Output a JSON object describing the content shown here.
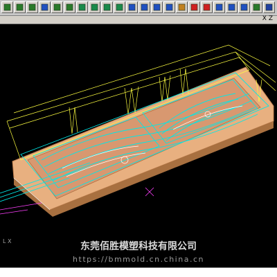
{
  "toolbar": {
    "buttons": [
      {
        "name": "zoom-window-icon",
        "color": "#2a7a2a"
      },
      {
        "name": "zoom-fit-icon",
        "color": "#2a7a2a"
      },
      {
        "name": "zoom-in-icon",
        "color": "#2a7a2a"
      },
      {
        "name": "pan-icon",
        "color": "#2050c0"
      },
      {
        "name": "rubber-band-icon",
        "color": "#2a7a2a"
      },
      {
        "name": "rotate-view-icon",
        "color": "#2a7a2a"
      },
      {
        "name": "iso-view-icon",
        "color": "#1a8a4a"
      },
      {
        "name": "top-view-icon",
        "color": "#1a8a4a"
      },
      {
        "name": "front-view-icon",
        "color": "#1a8a4a"
      },
      {
        "name": "side-view-icon",
        "color": "#1a8a4a"
      },
      {
        "name": "cube-view-icon",
        "color": "#2050c0"
      },
      {
        "name": "cube-back-icon",
        "color": "#2050c0"
      },
      {
        "name": "cube-right-icon",
        "color": "#2050c0"
      },
      {
        "name": "cube-left-icon",
        "color": "#2050c0"
      },
      {
        "name": "pencil-icon",
        "color": "#c08020"
      },
      {
        "name": "cancel-icon",
        "color": "#d02020"
      },
      {
        "name": "color-palette-icon",
        "color": "#d02020"
      },
      {
        "name": "shade-icon",
        "color": "#2050c0"
      },
      {
        "name": "undo-arrow-icon",
        "color": "#2050c0"
      },
      {
        "name": "sphere-icon",
        "color": "#2050c0"
      },
      {
        "name": "layers-icon",
        "color": "#2a7a2a"
      },
      {
        "name": "sum-icon",
        "color": "#2040a0"
      }
    ]
  },
  "viewport": {
    "axis_label": "X Z",
    "coord_label": "L X",
    "colors": {
      "background": "#000000",
      "plate": "#e8b080",
      "wire": "#00e8e8",
      "yellow": "#ffff40",
      "white": "#ffffff",
      "magenta": "#ff40ff"
    }
  },
  "watermark": {
    "company": "东莞佰胜模塑科技有限公司",
    "url": "https://bmmold.cn.china.cn"
  }
}
